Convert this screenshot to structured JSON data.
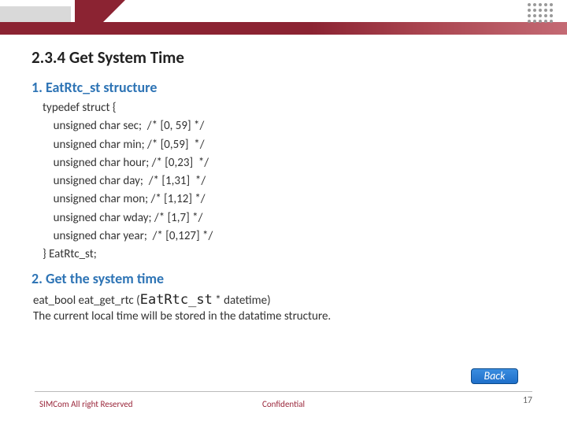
{
  "header": {
    "dot_count": 20
  },
  "section": {
    "title": "2.3.4 Get System Time",
    "sub1": "1. EatRtc_st structure",
    "code": "typedef struct {\n    unsigned char sec;  /* [0, 59] */\n    unsigned char min; /* [0,59]  */\n    unsigned char hour; /* [0,23]  */\n    unsigned char day;  /* [1,31]  */\n    unsigned char mon; /* [1,12] */\n    unsigned char wday; /* [1,7] */\n    unsigned char year;  /* [0,127] */\n} EatRtc_st;",
    "sub2": "2. Get the system time",
    "sig_prefix": "eat_bool eat_get_rtc (",
    "sig_type": "EatRtc_st",
    "sig_suffix": " * datetime)",
    "desc": "The current local time will be stored in the datatime structure."
  },
  "back_label": "Back",
  "footer": {
    "left": "SIMCom All right Reserved",
    "center": "Confidential",
    "page": "17"
  }
}
